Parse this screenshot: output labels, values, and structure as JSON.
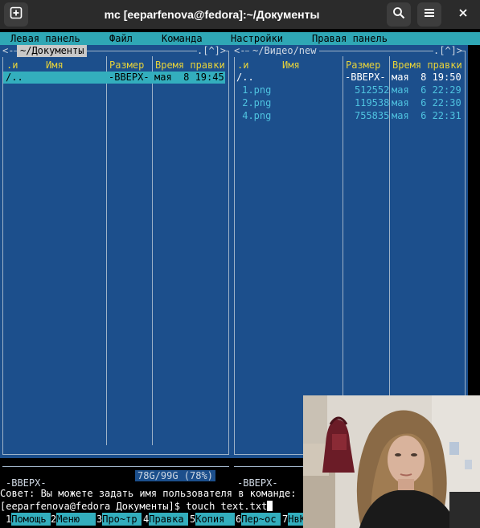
{
  "window": {
    "title": "mc [eeparfenova@fedora]:~/Документы",
    "new_tab_icon": "plus-square-icon",
    "search_icon": "search-icon",
    "menu_icon": "hamburger-menu-icon",
    "close_icon": "close-icon"
  },
  "menubar": {
    "items": [
      "Левая панель",
      "Файл",
      "Команда",
      "Настройки",
      "Правая панель"
    ]
  },
  "left_panel": {
    "path": "~/Документы",
    "corner_left": "<-",
    "corner_right": ".[^]>",
    "columns": [
      ".и",
      "Имя",
      "Размер",
      "Время правки"
    ],
    "rows": [
      {
        "name": "/..",
        "size": "-ВВЕРХ-",
        "time": "мая  8 19:45",
        "selected": true
      }
    ],
    "footer": "-ВВЕРХ-",
    "disk": "78G/99G (78%)"
  },
  "right_panel": {
    "path": "~/Видео/new",
    "corner_left": "<-",
    "corner_right": ".[^]>",
    "columns": [
      ".и",
      "Имя",
      "Размер",
      "Время правки"
    ],
    "rows": [
      {
        "name": "/..",
        "size": "-ВВЕРХ-",
        "time": "мая  8 19:50"
      },
      {
        "name": " 1.png",
        "size": "512552",
        "time": "мая  6 22:29"
      },
      {
        "name": " 2.png",
        "size": "119538",
        "time": "мая  6 22:30"
      },
      {
        "name": " 4.png",
        "size": "755835",
        "time": "мая  6 22:31"
      }
    ],
    "footer": "-ВВЕРХ-"
  },
  "hint": "Совет: Вы можете задать имя пользователя в команде: \"",
  "command_line": {
    "prompt": "[eeparfenova@fedora Документы]$ ",
    "input": "touch text.txt"
  },
  "fkeys": [
    {
      "num": "1",
      "label": "Помощь"
    },
    {
      "num": "2",
      "label": "Меню"
    },
    {
      "num": "3",
      "label": "Про~тр"
    },
    {
      "num": "4",
      "label": "Правка"
    },
    {
      "num": "5",
      "label": "Копия"
    },
    {
      "num": "6",
      "label": "Пер~ос"
    },
    {
      "num": "7",
      "label": "НвКтлг"
    }
  ],
  "colors": {
    "panel_bg": "#1c4f8c",
    "menubar_bg": "#2fa7b5",
    "selection_bg": "#33aebd",
    "header_text": "#e6d23a"
  }
}
